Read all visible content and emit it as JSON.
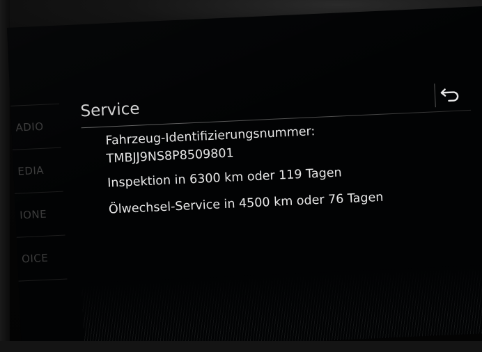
{
  "screen": {
    "title": "Service",
    "side_menu": [
      "ADIO",
      "EDIA",
      "IONE",
      "OICE"
    ],
    "lines": {
      "vin_label": "Fahrzeug-Identifizierungsnummer:",
      "vin_value": "TMBJJ9NS8P8509801",
      "inspection": "Inspektion in 6300 km oder 119 Tagen",
      "oil_service": "Ölwechsel-Service in 4500 km oder 76 Tagen"
    },
    "icons": {
      "back": "back-arrow-icon"
    }
  }
}
